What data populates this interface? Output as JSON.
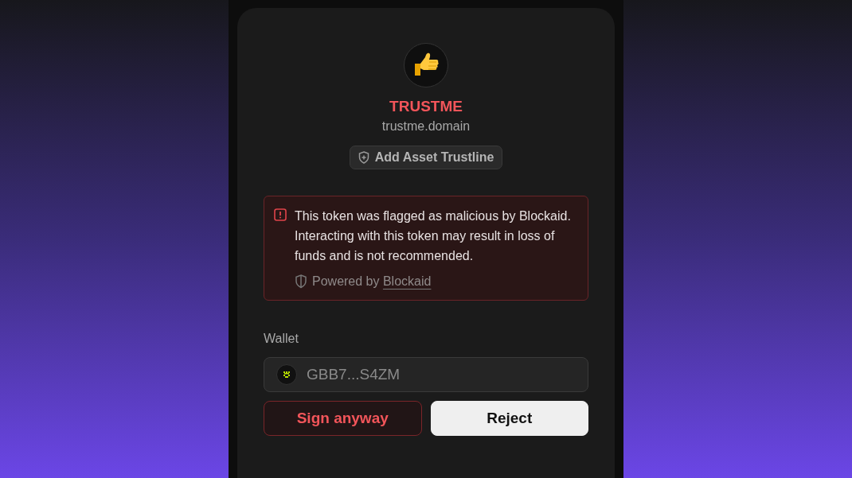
{
  "token": {
    "name": "TRUSTME",
    "domain": "trustme.domain",
    "flagged": true
  },
  "add_trustline_button": {
    "label": "Add Asset Trustline"
  },
  "warning": {
    "message": "This token was flagged as malicious by Blockaid. Interacting with this token may result in loss of funds and is not recommended.",
    "powered_by": "Powered by",
    "provider_link": "Blockaid"
  },
  "wallet": {
    "label": "Wallet",
    "address": "GBB7...S4ZM"
  },
  "buttons": [
    {
      "kind": "danger",
      "label": "Sign anyway"
    },
    {
      "kind": "primary",
      "label": "Reject"
    }
  ]
}
